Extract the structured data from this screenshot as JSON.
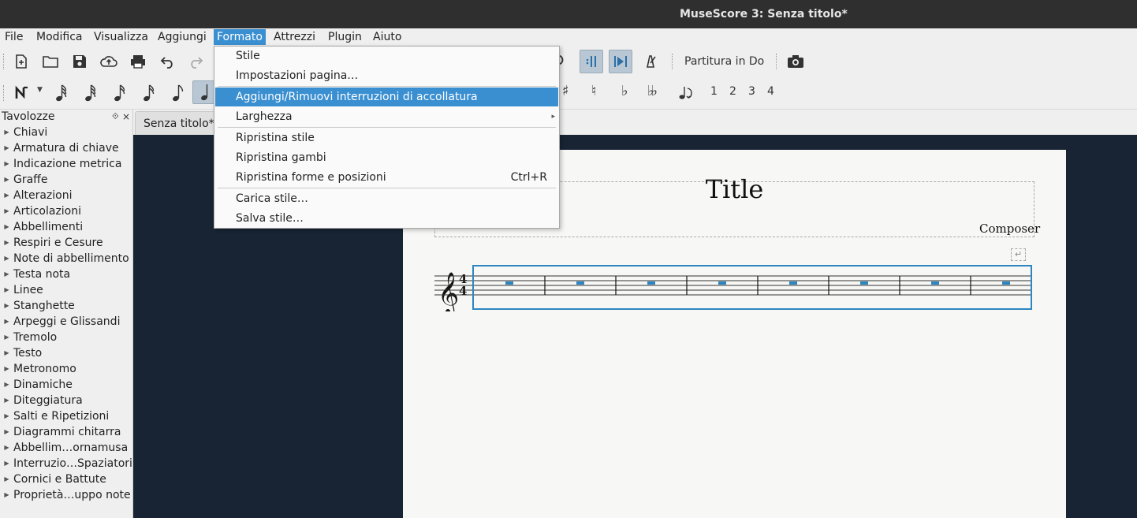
{
  "window": {
    "title": "MuseScore 3: Senza titolo*"
  },
  "menubar": {
    "items": [
      "File",
      "Modifica",
      "Visualizza",
      "Aggiungi",
      "Formato",
      "Attrezzi",
      "Plugin",
      "Aiuto"
    ],
    "active": "Formato"
  },
  "toolbar": {
    "concert_pitch_label": "Partitura in Do",
    "voices": [
      "1",
      "2",
      "3",
      "4"
    ]
  },
  "palette": {
    "title": "Tavolozze",
    "items": [
      "Chiavi",
      "Armatura di chiave",
      "Indicazione metrica",
      "Graffe",
      "Alterazioni",
      "Articolazioni",
      "Abbellimenti",
      "Respiri e Cesure",
      "Note di abbellimento",
      "Testa nota",
      "Linee",
      "Stanghette",
      "Arpeggi e Glissandi",
      "Tremolo",
      "Testo",
      "Metronomo",
      "Dinamiche",
      "Diteggiatura",
      "Salti e Ripetizioni",
      "Diagrammi chitarra",
      "Abbellim…ornamusa",
      "Interruzio…Spaziatori",
      "Cornici e Battute",
      "Proprietà…uppo note"
    ]
  },
  "document": {
    "tab_label": "Senza titolo*",
    "score_title": "Title",
    "composer": "Composer",
    "time_signature_top": "4",
    "time_signature_bottom": "4",
    "measures": 8
  },
  "formato_menu": {
    "items": [
      {
        "label": "Stile",
        "shortcut": ""
      },
      {
        "label": "Impostazioni pagina…",
        "shortcut": ""
      },
      {
        "label": "Aggiungi/Rimuovi interruzioni di accollatura",
        "shortcut": ""
      },
      {
        "label": "Larghezza",
        "shortcut": ""
      },
      {
        "label": "Ripristina stile",
        "shortcut": ""
      },
      {
        "label": "Ripristina gambi",
        "shortcut": ""
      },
      {
        "label": "Ripristina forme e posizioni",
        "shortcut": "Ctrl+R"
      },
      {
        "label": "Carica stile…",
        "shortcut": ""
      },
      {
        "label": "Salva stile…",
        "shortcut": ""
      }
    ],
    "highlighted": "Aggiungi/Rimuovi interruzioni di accollatura"
  },
  "colors": {
    "accent": "#3a8fd1",
    "canvas": "#182433",
    "titlebar": "#2f2f2f",
    "selection": "#2e86c1"
  }
}
